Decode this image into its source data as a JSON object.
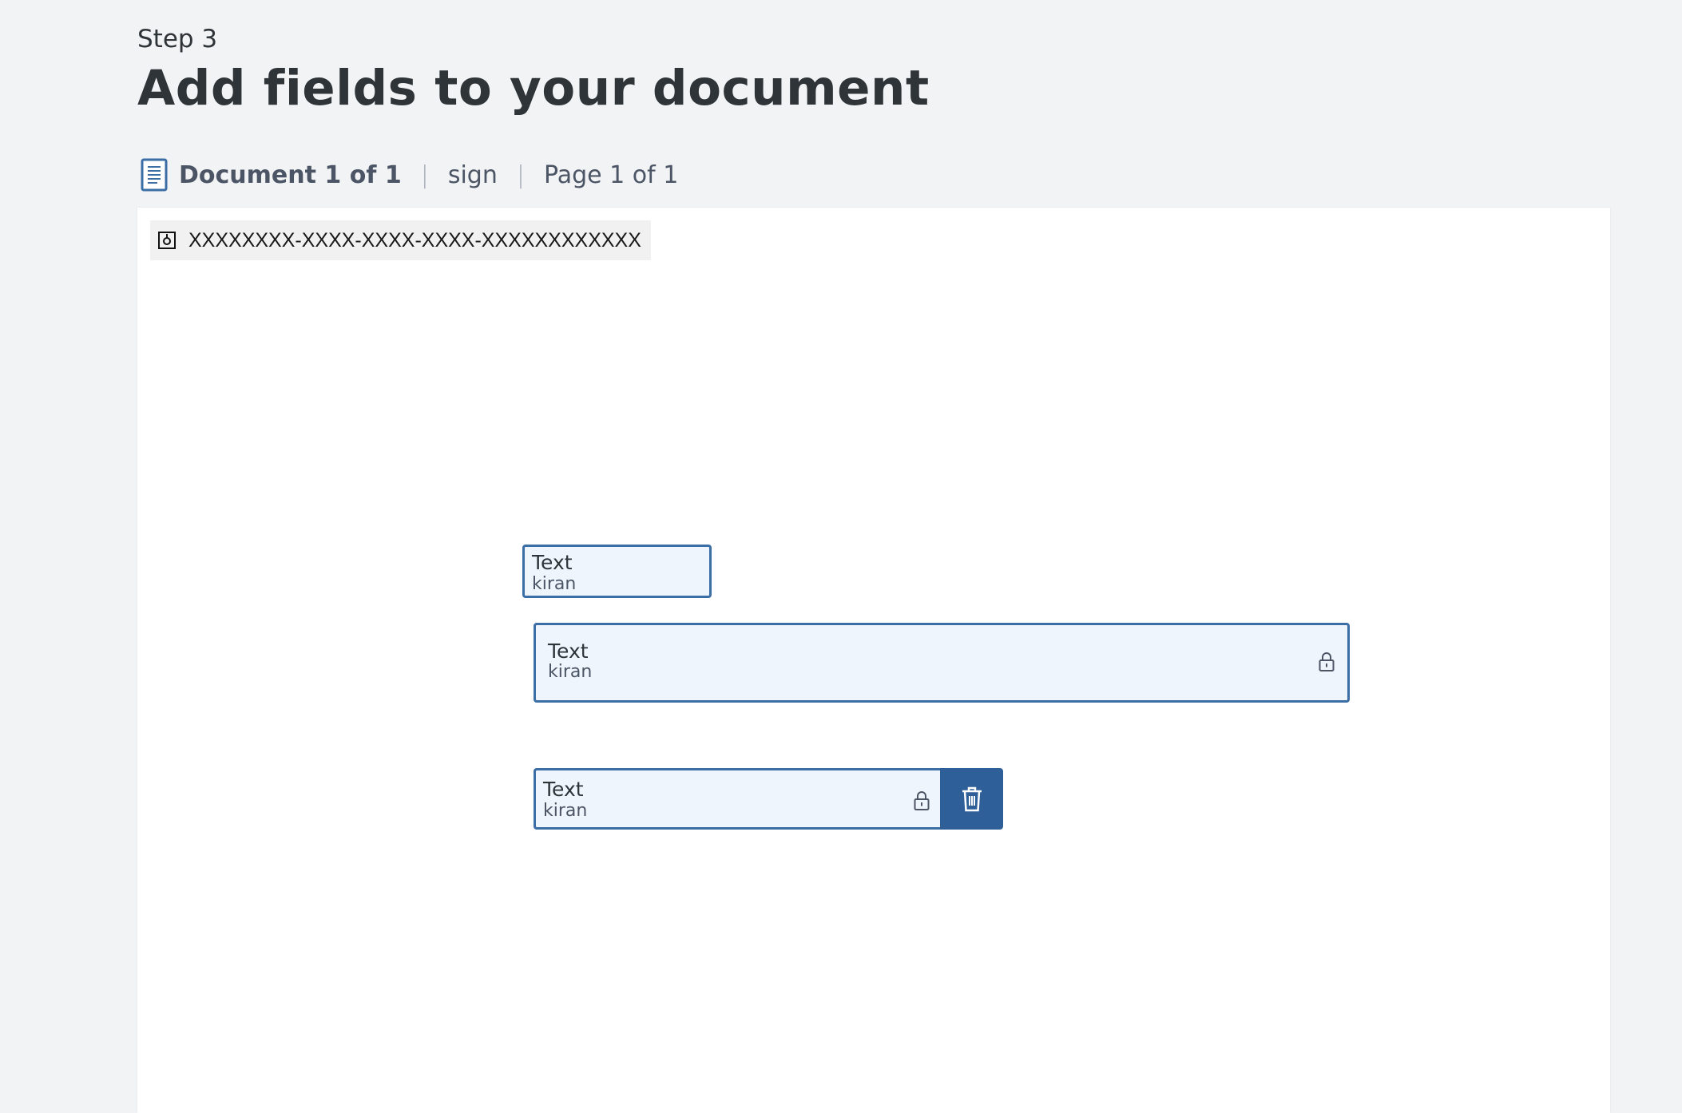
{
  "header": {
    "step": "Step 3",
    "title": "Add fields to your document"
  },
  "doc_nav": {
    "document_count": "Document 1 of 1",
    "separator": "|",
    "document_name": "sign",
    "page_count": "Page 1 of 1"
  },
  "canvas": {
    "envelope_id": "XXXXXXXX-XXXX-XXXX-XXXX-XXXXXXXXXXXX",
    "fields": [
      {
        "label": "Text",
        "recipient": "kiran",
        "locked": false
      },
      {
        "label": "Text",
        "recipient": "kiran",
        "locked": true
      },
      {
        "label": "Text",
        "recipient": "kiran",
        "locked": true,
        "selected": true
      }
    ]
  },
  "colors": {
    "page_bg": "#f2f3f5",
    "field_border": "#3a6ea5",
    "field_fill": "#eef5fd",
    "delete_bg": "#2f5f98",
    "text_dark": "#2f3438"
  }
}
